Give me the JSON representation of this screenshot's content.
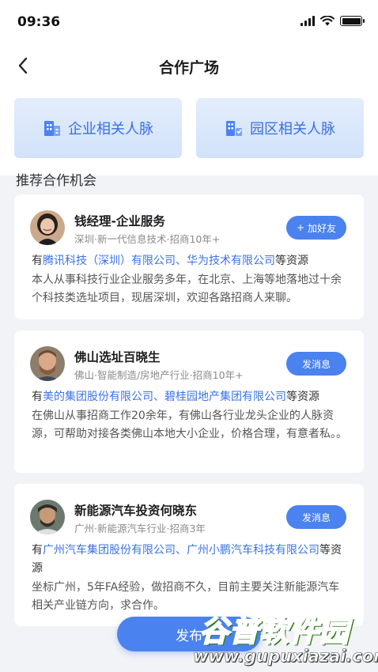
{
  "status_bar": {
    "time": "09:36"
  },
  "nav": {
    "title": "合作广场"
  },
  "entries": [
    {
      "label": "企业相关人脉",
      "icon": "building-icon"
    },
    {
      "label": "园区相关人脉",
      "icon": "park-icon"
    }
  ],
  "section_title": "推荐合作机会",
  "cards": [
    {
      "name": "钱经理-企业服务",
      "subtitle": "深圳·新一代信息技术·招商10年+",
      "button": "加好友",
      "button_prefix": "+",
      "res_prefix": "有",
      "res_companies": "腾讯科技（深圳）有限公司、华为技术有限公司",
      "res_suffix": "等资源",
      "description": "本人从事科技行业企业服务多年，在北京、上海等地落地过十余个科技类选址项目，现居深圳，欢迎各路招商人来聊。"
    },
    {
      "name": "佛山选址百晓生",
      "subtitle": "佛山·智能制造/房地产行业·招商10年+",
      "button": "发消息",
      "res_prefix": "有",
      "res_companies": "美的集团股份有限公司、碧桂园地产集团有限公司",
      "res_suffix": "等资源",
      "description": "在佛山从事招商工作20余年，有佛山各行业龙头企业的人脉资源，可帮助对接各类佛山本地大小企业，价格合理，有意者私。。"
    },
    {
      "name": "新能源汽车投资何晓东",
      "subtitle": "广州·新能源汽车行业·招商3年",
      "button": "发消息",
      "res_prefix": "有",
      "res_companies": "广州汽车集团股份有限公司、广州小鹏汽车科技有限公司",
      "res_suffix": "等资源",
      "description": "坐标广州，5年FA经验，做招商不久，目前主要关注新能源汽车相关产业链方向，求合作。"
    }
  ],
  "publish_button": "发布",
  "watermark": {
    "main": "谷普软件园",
    "url": "www.gupuxiazai.com"
  },
  "colors": {
    "accent": "#4a82ef",
    "link": "#3b72e8",
    "background": "#f2f3f7"
  }
}
